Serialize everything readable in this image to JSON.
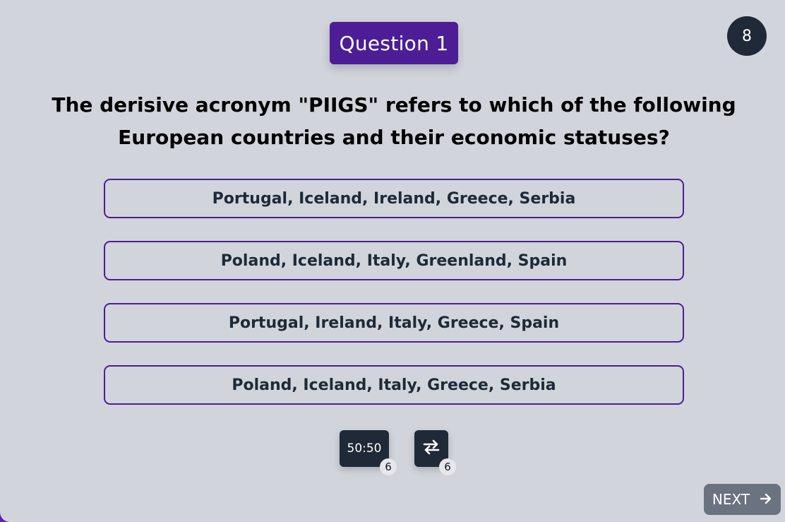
{
  "header": {
    "question_label": "Question 1",
    "timer_value": "8"
  },
  "question": {
    "text": "The derisive acronym \"PIIGS\" refers to which of the following European countries and their economic statuses?"
  },
  "answers": [
    {
      "label": "Portugal, Iceland, Ireland, Greece, Serbia"
    },
    {
      "label": "Poland, Iceland, Italy, Greenland, Spain"
    },
    {
      "label": "Portugal, Ireland, Italy, Greece, Spain"
    },
    {
      "label": "Poland, Iceland, Italy, Greece, Serbia"
    }
  ],
  "lifelines": {
    "fifty_fifty": {
      "label": "50:50",
      "count": "6",
      "icon": "fifty-fifty-icon"
    },
    "swap": {
      "count": "6",
      "icon": "swap-arrows-icon"
    }
  },
  "footer": {
    "next_label": "NEXT",
    "next_icon": "arrow-right-icon"
  },
  "colors": {
    "background": "#d1d5db",
    "accent": "#4c1d95",
    "dark": "#1f2937",
    "next_button": "#6b7280"
  }
}
